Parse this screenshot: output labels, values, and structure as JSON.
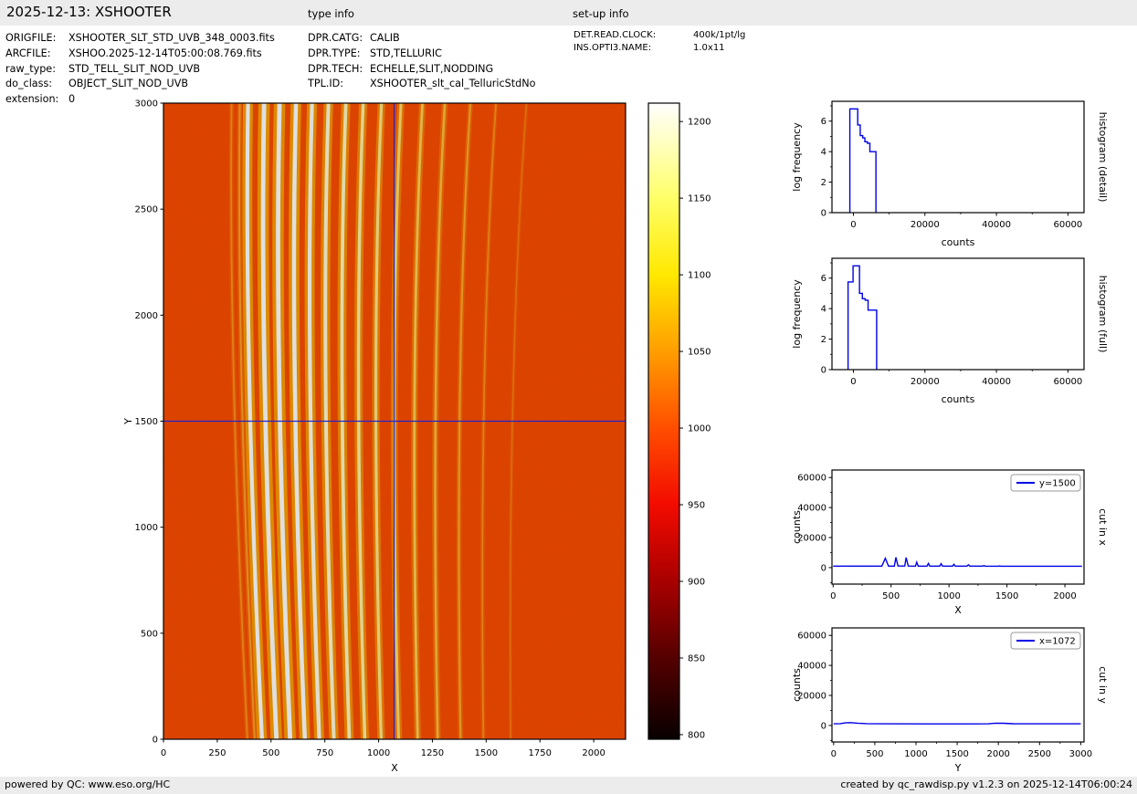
{
  "header": {
    "title": "2025-12-13: XSHOOTER",
    "type_info_heading": "type info",
    "setup_info_heading": "set-up info"
  },
  "meta": {
    "file_info": [
      {
        "label": "ORIGFILE:",
        "value": "XSHOOTER_SLT_STD_UVB_348_0003.fits"
      },
      {
        "label": "ARCFILE:",
        "value": "XSHOO.2025-12-14T05:00:08.769.fits"
      },
      {
        "label": "raw_type:",
        "value": "STD_TELL_SLIT_NOD_UVB"
      },
      {
        "label": "do_class:",
        "value": "OBJECT_SLIT_NOD_UVB"
      },
      {
        "label": "extension:",
        "value": "0"
      }
    ],
    "type_info": [
      {
        "label": "DPR.CATG:",
        "value": "CALIB"
      },
      {
        "label": "DPR.TYPE:",
        "value": "STD,TELLURIC"
      },
      {
        "label": "DPR.TECH:",
        "value": "ECHELLE,SLIT,NODDING"
      },
      {
        "label": "TPL.ID:",
        "value": "XSHOOTER_slt_cal_TelluricStdNo"
      }
    ],
    "setup_info": [
      {
        "label": "DET.READ.CLOCK:",
        "value": "400k/1pt/lg"
      },
      {
        "label": "INS.OPTI3.NAME:",
        "value": "1.0x11"
      }
    ]
  },
  "footer": {
    "left": "powered by QC: www.eso.org/HC",
    "right": "created by qc_rawdisp.py v1.2.3 on 2025-12-14T06:00:24"
  },
  "colors": {
    "bar_background": "#ececec",
    "plot_line_blue": "#0000e8",
    "crosshair_blue": "#2424cc",
    "image_background": "#fb4d00",
    "axis_black": "#000000"
  },
  "chart_data": [
    {
      "id": "main-image",
      "type": "heatmap",
      "description": "Raw XSHOOTER UVB echelle frame: curved spectral orders, bright white-yellow at left-center fading to faint orange at right, on hot-colormap orange background",
      "xlabel": "X",
      "ylabel": "Y",
      "xlim": [
        0,
        2148
      ],
      "ylim": [
        0,
        3000
      ],
      "xticks": [
        0,
        250,
        500,
        750,
        1000,
        1250,
        1500,
        1750,
        2000
      ],
      "yticks": [
        0,
        500,
        1000,
        1500,
        2000,
        2500,
        3000
      ],
      "colormap": "hot",
      "background_color": "#fb4d00",
      "background_value_counts": 1000,
      "crosshair": {
        "x": 1072,
        "y": 1500,
        "color": "#2424cc"
      },
      "orders": [
        {
          "xb": 390,
          "w": 1.8,
          "core": "#ffc340",
          "glow": "#ffa600",
          "op": 0.5
        },
        {
          "xb": 424,
          "w": 2.0,
          "core": "#ffd050",
          "glow": "#ffae00",
          "op": 0.55
        },
        {
          "xb": 458,
          "w": 4.2,
          "core": "#ffffff",
          "glow": "#fff000",
          "op": 1.0
        },
        {
          "xb": 525,
          "w": 4.8,
          "core": "#ffffff",
          "glow": "#fff000",
          "op": 1.0
        },
        {
          "xb": 589,
          "w": 4.8,
          "core": "#ffffff",
          "glow": "#fff000",
          "op": 1.0
        },
        {
          "xb": 657,
          "w": 4.5,
          "core": "#ffffff",
          "glow": "#ffee00",
          "op": 1.0
        },
        {
          "xb": 724,
          "w": 4.2,
          "core": "#fffff4",
          "glow": "#ffec00",
          "op": 0.98
        },
        {
          "xb": 792,
          "w": 4.0,
          "core": "#ffffe2",
          "glow": "#ffe600",
          "op": 0.95
        },
        {
          "xb": 864,
          "w": 3.8,
          "core": "#ffffcc",
          "glow": "#ffe000",
          "op": 0.93
        },
        {
          "xb": 936,
          "w": 3.5,
          "core": "#fffbb4",
          "glow": "#ffda00",
          "op": 0.9
        },
        {
          "xb": 1012,
          "w": 3.2,
          "core": "#fff49a",
          "glow": "#ffd200",
          "op": 0.88
        },
        {
          "xb": 1093,
          "w": 3.0,
          "core": "#ffee82",
          "glow": "#ffca00",
          "op": 0.85
        },
        {
          "xb": 1182,
          "w": 2.8,
          "core": "#ffe56c",
          "glow": "#ffc100",
          "op": 0.8
        },
        {
          "xb": 1275,
          "w": 2.6,
          "core": "#ffdb58",
          "glow": "#ffb700",
          "op": 0.72
        },
        {
          "xb": 1381,
          "w": 2.2,
          "core": "#ffd046",
          "glow": "#ffab00",
          "op": 0.62
        },
        {
          "xb": 1487,
          "w": 1.8,
          "core": "#ffc438",
          "glow": "#ff9f00",
          "op": 0.5
        },
        {
          "xb": 1614,
          "w": 1.6,
          "core": "#ffb72c",
          "glow": "#ff9300",
          "op": 0.38
        }
      ]
    },
    {
      "id": "colorbar",
      "type": "colorbar",
      "vmin": 797,
      "vmax": 1212,
      "ticks": [
        800,
        850,
        900,
        950,
        1000,
        1050,
        1100,
        1150,
        1200
      ],
      "gradient_top_to_bottom": [
        [
          "#ffffff",
          0
        ],
        [
          "#ffffe2",
          0.029
        ],
        [
          "#ffff69",
          0.149
        ],
        [
          "#ffe800",
          0.27
        ],
        [
          "#ff9e00",
          0.39
        ],
        [
          "#ff4e00",
          0.511
        ],
        [
          "#f30b00",
          0.631
        ],
        [
          "#a80000",
          0.752
        ],
        [
          "#550000",
          0.872
        ],
        [
          "#0c0000",
          0.993
        ],
        [
          "#070000",
          1
        ]
      ]
    },
    {
      "id": "hist-detail",
      "type": "histogram-step",
      "right_label": "histogram (detail)",
      "xlabel": "counts",
      "ylabel": "log frequency",
      "xlim": [
        -6000,
        64500
      ],
      "ylim": [
        0,
        7.3
      ],
      "xticks": [
        0,
        20000,
        40000,
        60000
      ],
      "x_minor_step": 10000,
      "yticks": [
        0,
        2,
        4,
        6
      ],
      "y_minor_step": 1,
      "line_color": "#0000e8",
      "steps": [
        [
          -1000,
          6.8
        ],
        [
          1200,
          5.75
        ],
        [
          1900,
          5.05
        ],
        [
          2600,
          4.9
        ],
        [
          3200,
          4.65
        ],
        [
          3900,
          4.55
        ],
        [
          4600,
          4.0
        ],
        [
          6300,
          0
        ]
      ]
    },
    {
      "id": "hist-full",
      "type": "histogram-step",
      "right_label": "histogram (full)",
      "xlabel": "counts",
      "ylabel": "log frequency",
      "xlim": [
        -6000,
        64500
      ],
      "ylim": [
        0,
        7.3
      ],
      "xticks": [
        0,
        20000,
        40000,
        60000
      ],
      "x_minor_step": 10000,
      "yticks": [
        0,
        2,
        4,
        6
      ],
      "y_minor_step": 1,
      "line_color": "#0000e8",
      "steps": [
        [
          -1500,
          5.75
        ],
        [
          -100,
          6.8
        ],
        [
          1700,
          5.0
        ],
        [
          2500,
          4.65
        ],
        [
          3300,
          4.55
        ],
        [
          4100,
          3.9
        ],
        [
          6500,
          0
        ]
      ]
    },
    {
      "id": "cut-x",
      "type": "line",
      "right_label": "cut in x",
      "legend": "y=1500",
      "xlabel": "X",
      "ylabel": "counts",
      "xlim": [
        -10,
        2165
      ],
      "ylim": [
        -11000,
        65000
      ],
      "xticks": [
        0,
        500,
        1000,
        1500,
        2000
      ],
      "x_minor_step": 250,
      "yticks": [
        0,
        20000,
        40000,
        60000
      ],
      "y_minor_step": 10000,
      "line_color": "#0000e8",
      "points": [
        [
          0,
          1000
        ],
        [
          420,
          1000
        ],
        [
          450,
          6200
        ],
        [
          478,
          1000
        ],
        [
          528,
          1000
        ],
        [
          542,
          6800
        ],
        [
          560,
          1050
        ],
        [
          618,
          1050
        ],
        [
          630,
          6700
        ],
        [
          648,
          1050
        ],
        [
          710,
          1000
        ],
        [
          721,
          3600
        ],
        [
          734,
          1000
        ],
        [
          810,
          1000
        ],
        [
          822,
          2800
        ],
        [
          834,
          1000
        ],
        [
          920,
          1000
        ],
        [
          932,
          2600
        ],
        [
          944,
          1000
        ],
        [
          1030,
          980
        ],
        [
          1042,
          2200
        ],
        [
          1054,
          980
        ],
        [
          1155,
          950
        ],
        [
          1167,
          1900
        ],
        [
          1179,
          950
        ],
        [
          1290,
          950
        ],
        [
          1301,
          1300
        ],
        [
          1312,
          950
        ],
        [
          1425,
          940
        ],
        [
          1436,
          1100
        ],
        [
          1447,
          940
        ],
        [
          2148,
          940
        ]
      ]
    },
    {
      "id": "cut-y",
      "type": "line",
      "right_label": "cut in y",
      "legend": "x=1072",
      "xlabel": "Y",
      "ylabel": "counts",
      "xlim": [
        -20,
        3040
      ],
      "ylim": [
        -11000,
        65000
      ],
      "xticks": [
        0,
        500,
        1000,
        1500,
        2000,
        2500,
        3000
      ],
      "x_minor_step": 250,
      "yticks": [
        0,
        20000,
        40000,
        60000
      ],
      "y_minor_step": 10000,
      "line_color": "#0000e8",
      "points": [
        [
          0,
          1100
        ],
        [
          80,
          1250
        ],
        [
          150,
          1800
        ],
        [
          210,
          1900
        ],
        [
          290,
          1550
        ],
        [
          400,
          1200
        ],
        [
          600,
          1100
        ],
        [
          1200,
          1060
        ],
        [
          1700,
          1050
        ],
        [
          1880,
          1100
        ],
        [
          1960,
          1500
        ],
        [
          2060,
          1480
        ],
        [
          2180,
          1150
        ],
        [
          2400,
          1080
        ],
        [
          3000,
          1080
        ]
      ]
    }
  ]
}
